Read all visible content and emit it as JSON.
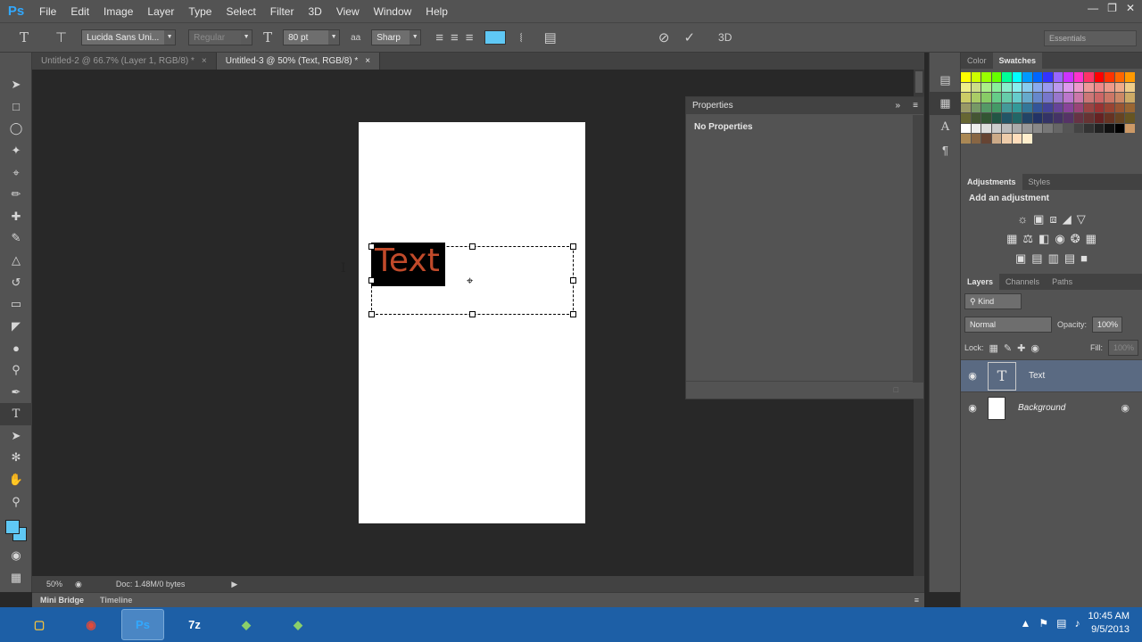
{
  "app": {
    "logo": "Ps",
    "menus": [
      "File",
      "Edit",
      "Image",
      "Layer",
      "Type",
      "Select",
      "Filter",
      "3D",
      "View",
      "Window",
      "Help"
    ],
    "window_controls": [
      "minimize-icon",
      "restore-icon",
      "close-icon"
    ]
  },
  "options_bar": {
    "font_family": "Lucida Sans Uni...",
    "font_style": "Regular",
    "font_size": "80 pt",
    "anti_alias": "Sharp",
    "text_color": "#5fc8f5",
    "workspace": "Essentials"
  },
  "doc_tabs": [
    {
      "label": "Untitled-2 @ 66.7% (Layer 1, RGB/8) *",
      "active": false
    },
    {
      "label": "Untitled-3 @ 50% (Text, RGB/8) *",
      "active": true
    }
  ],
  "canvas": {
    "text_content": "Text",
    "text_color": "#c14a2a",
    "highlight_color": "#000000"
  },
  "status": {
    "zoom": "50%",
    "doc_info": "Doc: 1.48M/0 bytes"
  },
  "bottom_tabs": [
    "Mini Bridge",
    "Timeline"
  ],
  "properties": {
    "title": "Properties",
    "body": "No Properties"
  },
  "right_panels": {
    "color_tab": "Color",
    "swatches_tab": "Swatches",
    "adjustments_tab": "Adjustments",
    "styles_tab": "Styles",
    "add_adjustment": "Add an adjustment",
    "layers_tab": "Layers",
    "channels_tab": "Channels",
    "paths_tab": "Paths",
    "filter_kind": "Kind",
    "blend_mode": "Normal",
    "opacity_label": "Opacity:",
    "opacity_value": "100%",
    "lock_label": "Lock:",
    "fill_label": "Fill:",
    "fill_value": "100%"
  },
  "layers": [
    {
      "name": "Text",
      "type": "text",
      "selected": true
    },
    {
      "name": "Background",
      "type": "pixel",
      "selected": false,
      "locked": true
    }
  ],
  "taskbar": {
    "apps": [
      "explorer-icon",
      "chrome-icon",
      "photoshop-icon",
      "7zip-icon",
      "app-icon",
      "app-icon"
    ],
    "time": "10:45 AM",
    "date": "9/5/2013"
  }
}
